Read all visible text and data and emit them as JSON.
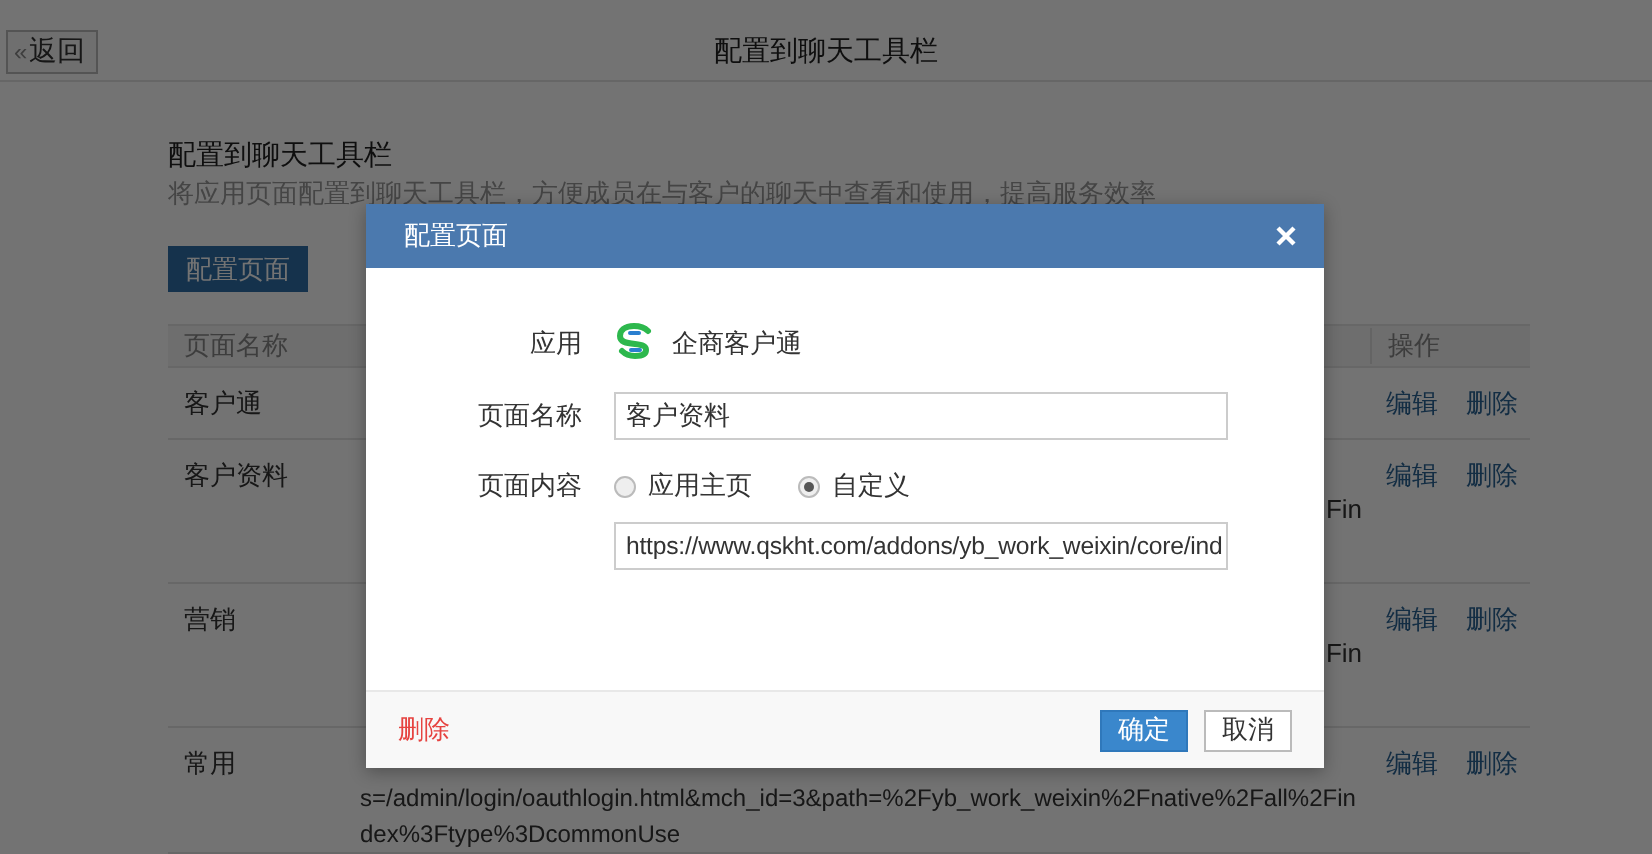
{
  "topbar": {
    "back_button": {
      "icon": "«",
      "label": "返回"
    },
    "title": "配置到聊天工具栏"
  },
  "section": {
    "title": "配置到聊天工具栏",
    "description": "将应用页面配置到聊天工具栏，方便成员在与客户的聊天中查看和使用，提高服务效率",
    "button": "配置页面"
  },
  "table": {
    "columns": [
      "页面名称",
      "操作"
    ],
    "rows": [
      {
        "name": "客户通",
        "actions": [
          "编辑",
          "删除"
        ]
      },
      {
        "name": "客户资料",
        "content_fragment": "Fin",
        "actions": [
          "编辑",
          "删除"
        ]
      },
      {
        "name": "营销",
        "content_fragment": "Fin",
        "actions": [
          "编辑",
          "删除"
        ]
      },
      {
        "name": "常用",
        "content": [
          "s=/admin/login/oauthlogin.html&mch_id=3&path=%2Fyb_work_weixin%2Fnative%2Fall%2Fin",
          "dex%3Ftype%3DcommonUse"
        ],
        "actions": [
          "编辑",
          "删除"
        ]
      }
    ]
  },
  "modal": {
    "title": "配置页面",
    "app_label": "应用",
    "app_name": "企商客户通",
    "name_label": "页面名称",
    "name_value": "客户资料",
    "content_label": "页面内容",
    "options": [
      {
        "label": "应用主页",
        "selected": false
      },
      {
        "label": "自定义",
        "selected": true
      }
    ],
    "url_value": "https://www.qskht.com/addons/yb_work_weixin/core/ind",
    "delete": "删除",
    "confirm": "确定",
    "cancel": "取消"
  }
}
